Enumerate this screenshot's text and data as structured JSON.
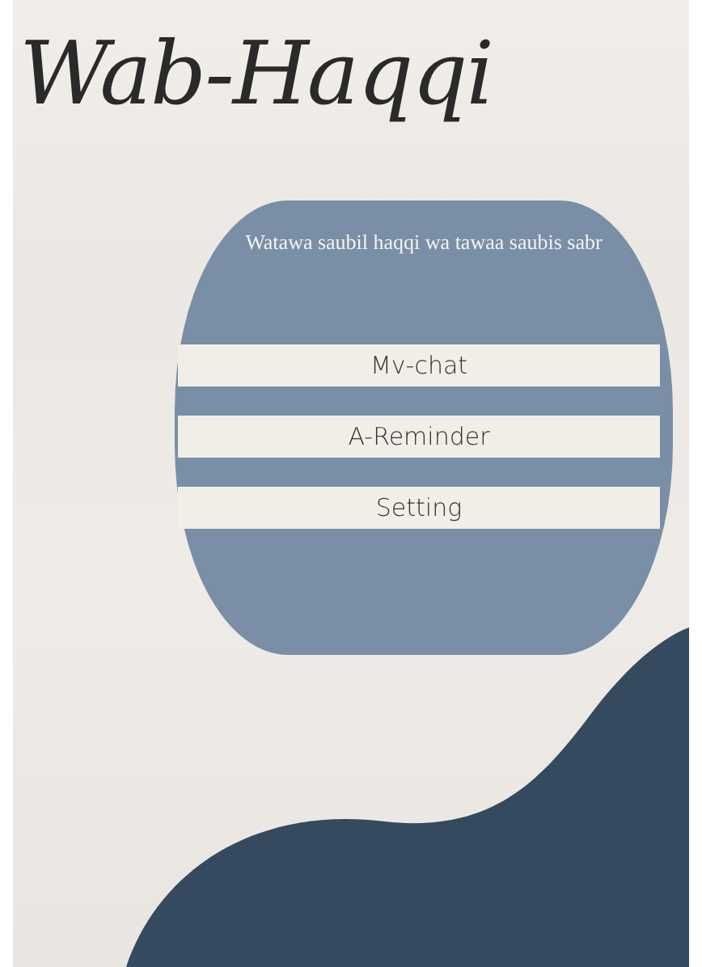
{
  "title": "Wab-Haqqi",
  "card": {
    "motto": "Watawa saubil haqqi wa tawaa saubis sabr",
    "buttons": [
      {
        "label": "Mv-chat"
      },
      {
        "label": "A-Reminder"
      },
      {
        "label": "Setting"
      }
    ]
  }
}
